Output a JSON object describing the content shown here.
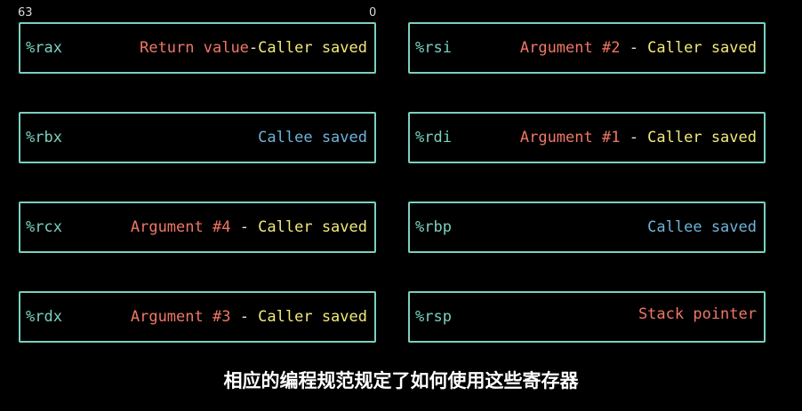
{
  "bit_labels": {
    "high": "63",
    "low": "0"
  },
  "colors": {
    "border": "#79d1c0",
    "register_name": "#79d1c0",
    "argument": "#f07766",
    "caller_saved": "#f2e97a",
    "callee_saved": "#6fb3da",
    "background": "#000000"
  },
  "registers": {
    "rax": {
      "name": "%rax",
      "role": "Return value",
      "sep": "-",
      "save": "Caller saved"
    },
    "rbx": {
      "name": "%rbx",
      "save": "Callee saved"
    },
    "rcx": {
      "name": "%rcx",
      "role": "Argument #4",
      "sep": " - ",
      "save": "Caller saved"
    },
    "rdx": {
      "name": "%rdx",
      "role": "Argument #3",
      "sep": " - ",
      "save": "Caller saved"
    },
    "rsi": {
      "name": "%rsi",
      "role": "Argument #2",
      "sep": " - ",
      "save": "Caller saved"
    },
    "rdi": {
      "name": "%rdi",
      "role": "Argument #1",
      "sep": " - ",
      "save": "Caller saved"
    },
    "rbp": {
      "name": "%rbp",
      "save": "Callee saved"
    },
    "rsp": {
      "name": "%rsp",
      "role": "Stack pointer"
    }
  },
  "caption": "相应的编程规范规定了如何使用这些寄存器"
}
